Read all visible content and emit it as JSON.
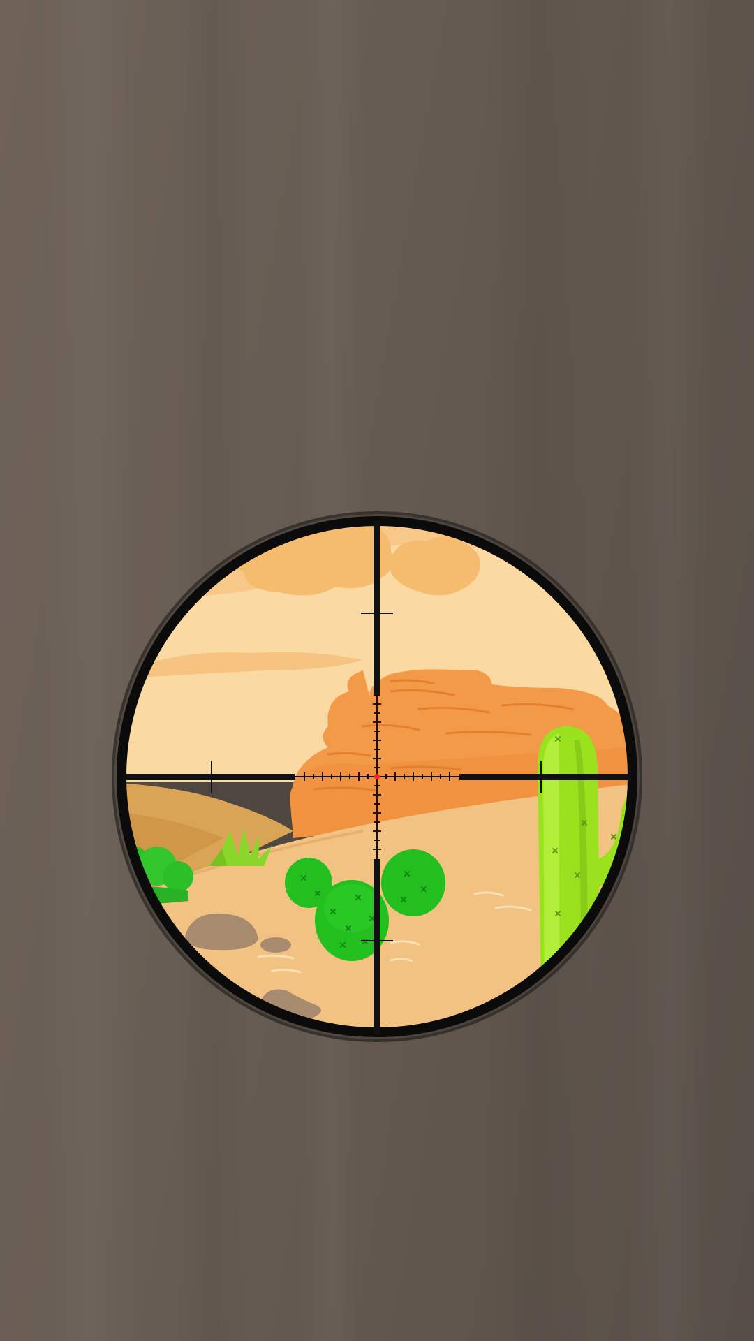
{
  "game": {
    "view": "sniper-scope",
    "scene": "desert",
    "colors": {
      "wall": "#685d54",
      "scope_ring": "#0b0b0b",
      "reticle": "#111111",
      "aim_dot": "#ff2020",
      "sky": "#fbd9a3",
      "cloud": "#f6bd72",
      "mesa": "#f29a48",
      "sand": "#f2c283",
      "far_dune": "#d9a456",
      "cactus_light": "#9be21e",
      "cactus_dark": "#22bf1e",
      "rock": "#a88a6f"
    },
    "icons": {
      "scope": "scope-reticle-icon",
      "aim": "red-dot-icon"
    }
  }
}
